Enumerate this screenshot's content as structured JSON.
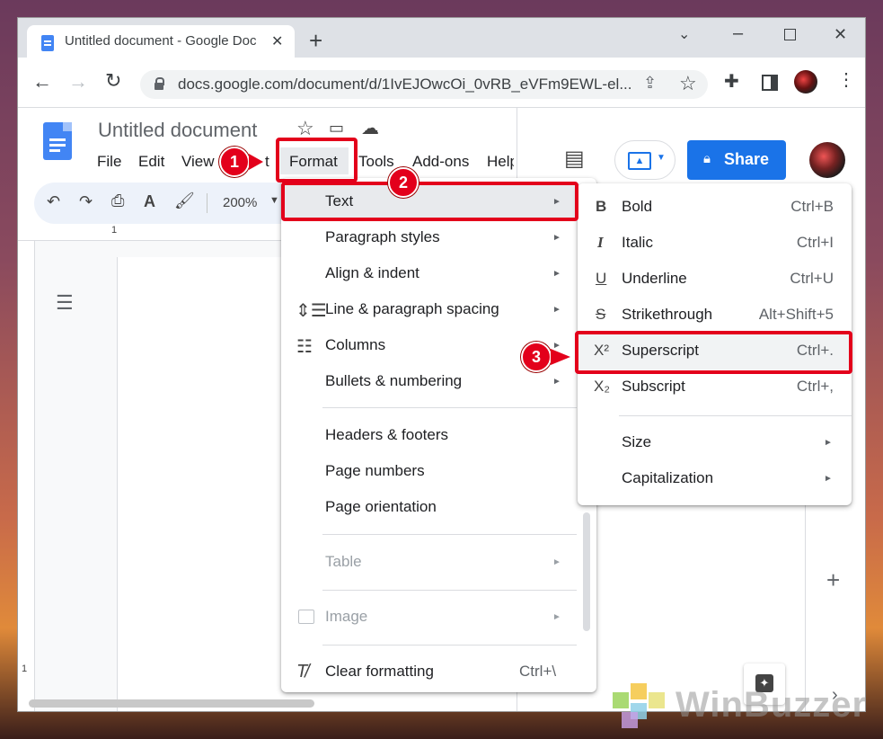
{
  "browser": {
    "tab_title": "Untitled document - Google Doc",
    "new_tab": "+",
    "url": "docs.google.com/document/d/1IvEJOwcOi_0vRB_eVFm9EWL-el..."
  },
  "docs": {
    "title": "Untitled document",
    "menus": [
      "File",
      "Edit",
      "View",
      "Insert",
      "Format",
      "Tools",
      "Add-ons",
      "Help"
    ],
    "menu_visible": {
      "file": "File",
      "edit": "Edit",
      "view": "View",
      "insert_fragment": "t",
      "format": "Format",
      "tools": "Tools",
      "addons": "Add-ons",
      "help": "Help"
    },
    "share_label": "Share",
    "zoom": "200%",
    "ruler_mark": "1",
    "vruler_mark": "1"
  },
  "format_menu": {
    "items": [
      {
        "label": "Text",
        "submenu": true,
        "highlighted": true
      },
      {
        "label": "Paragraph styles",
        "submenu": true
      },
      {
        "label": "Align & indent",
        "submenu": true
      },
      {
        "label": "Line & paragraph spacing",
        "submenu": true
      },
      {
        "label": "Columns",
        "submenu": true
      },
      {
        "label": "Bullets & numbering",
        "submenu": true
      },
      {
        "label": "Headers & footers"
      },
      {
        "label": "Page numbers"
      },
      {
        "label": "Page orientation"
      },
      {
        "label": "Table",
        "submenu": true,
        "disabled": true
      },
      {
        "label": "Image",
        "submenu": true,
        "disabled": true
      },
      {
        "label": "Clear formatting",
        "shortcut": "Ctrl+\\"
      }
    ]
  },
  "text_submenu": {
    "items": [
      {
        "glyph": "B",
        "label": "Bold",
        "shortcut": "Ctrl+B"
      },
      {
        "glyph": "I",
        "label": "Italic",
        "shortcut": "Ctrl+I"
      },
      {
        "glyph": "U",
        "label": "Underline",
        "shortcut": "Ctrl+U"
      },
      {
        "glyph": "S",
        "label": "Strikethrough",
        "shortcut": "Alt+Shift+5"
      },
      {
        "glyph": "X²",
        "label": "Superscript",
        "shortcut": "Ctrl+."
      },
      {
        "glyph": "X₂",
        "label": "Subscript",
        "shortcut": "Ctrl+,"
      },
      {
        "label": "Size",
        "submenu": true
      },
      {
        "label": "Capitalization",
        "submenu": true
      }
    ]
  },
  "annotations": {
    "step1": "1",
    "step2": "2",
    "step3": "3"
  },
  "watermark": "WinBuzzer",
  "colors": {
    "accent_red": "#e3001b",
    "share_blue": "#1a73e8",
    "docs_blue": "#4285f4"
  }
}
